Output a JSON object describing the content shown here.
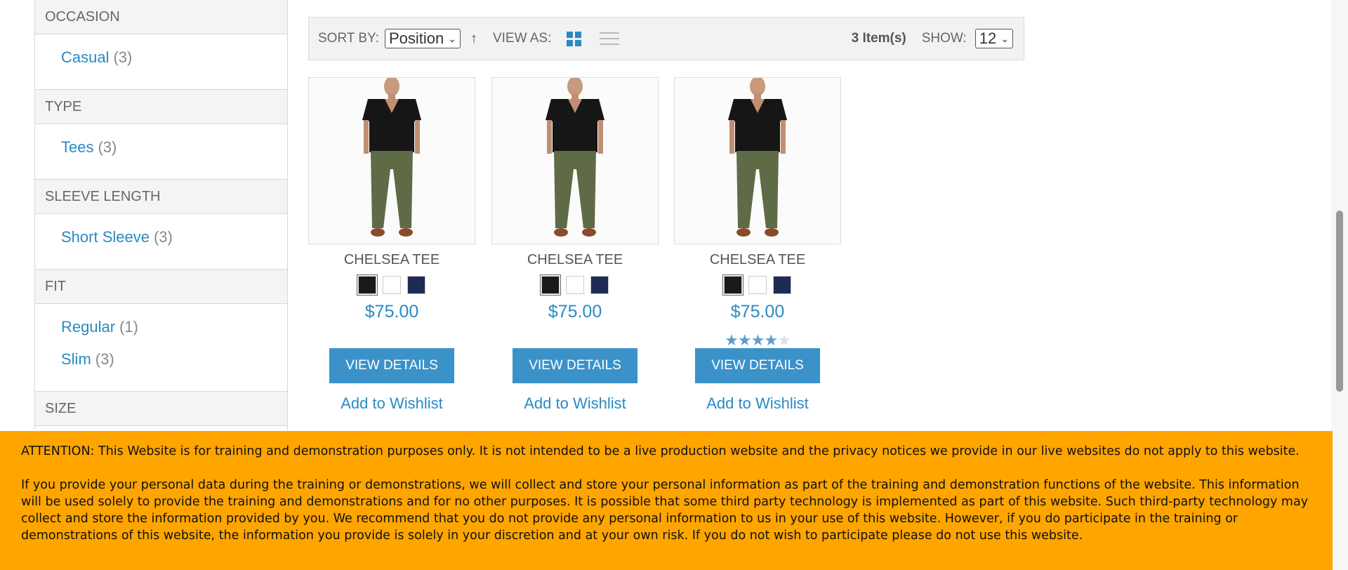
{
  "sidebar": {
    "groups": [
      {
        "title": "OCCASION",
        "options": [
          {
            "label": "Casual",
            "count": "(3)"
          }
        ]
      },
      {
        "title": "TYPE",
        "options": [
          {
            "label": "Tees",
            "count": "(3)"
          }
        ]
      },
      {
        "title": "SLEEVE LENGTH",
        "options": [
          {
            "label": "Short Sleeve",
            "count": "(3)"
          }
        ]
      },
      {
        "title": "FIT",
        "options": [
          {
            "label": "Regular",
            "count": "(1)"
          },
          {
            "label": "Slim",
            "count": "(3)"
          }
        ]
      },
      {
        "title": "SIZE",
        "options": []
      }
    ]
  },
  "toolbar": {
    "sort_label": "SORT BY:",
    "sort_value": "Position",
    "sort_direction_icon": "arrow-up-icon",
    "view_label": "VIEW AS:",
    "item_count": "3 Item(s)",
    "show_label": "SHOW:",
    "show_value": "12"
  },
  "products": [
    {
      "name": "CHELSEA TEE",
      "price": "$75.00",
      "rating": null,
      "details_label": "VIEW DETAILS",
      "wishlist_label": "Add to Wishlist"
    },
    {
      "name": "CHELSEA TEE",
      "price": "$75.00",
      "rating": null,
      "details_label": "VIEW DETAILS",
      "wishlist_label": "Add to Wishlist"
    },
    {
      "name": "CHELSEA TEE",
      "price": "$75.00",
      "rating": 4,
      "details_label": "VIEW DETAILS",
      "wishlist_label": "Add to Wishlist"
    }
  ],
  "swatch_colors": [
    "#1a1a1a",
    "#ffffff",
    "#1f2a55"
  ],
  "colors": {
    "accent": "#2a8ac4",
    "button": "#3a92c9",
    "notice_bg": "#ffa500"
  },
  "notice": {
    "p1": "ATTENTION: This Website is for training and demonstration purposes only. It is not intended to be a live production website and the privacy notices we provide in our live websites do not apply to this website.",
    "p2": "If you provide your personal data during the training or demonstrations, we will collect and store your personal information as part of the training and demonstration functions of the website. This information will be used solely to provide the training and demonstrations and for no other purposes. It is possible that some third party technology is implemented as part of this website. Such third-party technology may collect and store the information provided by you. We recommend that you do not provide any personal information to us in your use of this website. However, if you do participate in the training or demonstrations of this website, the information you provide is solely in your discretion and at your own risk. If you do not wish to participate please do not use this website."
  }
}
